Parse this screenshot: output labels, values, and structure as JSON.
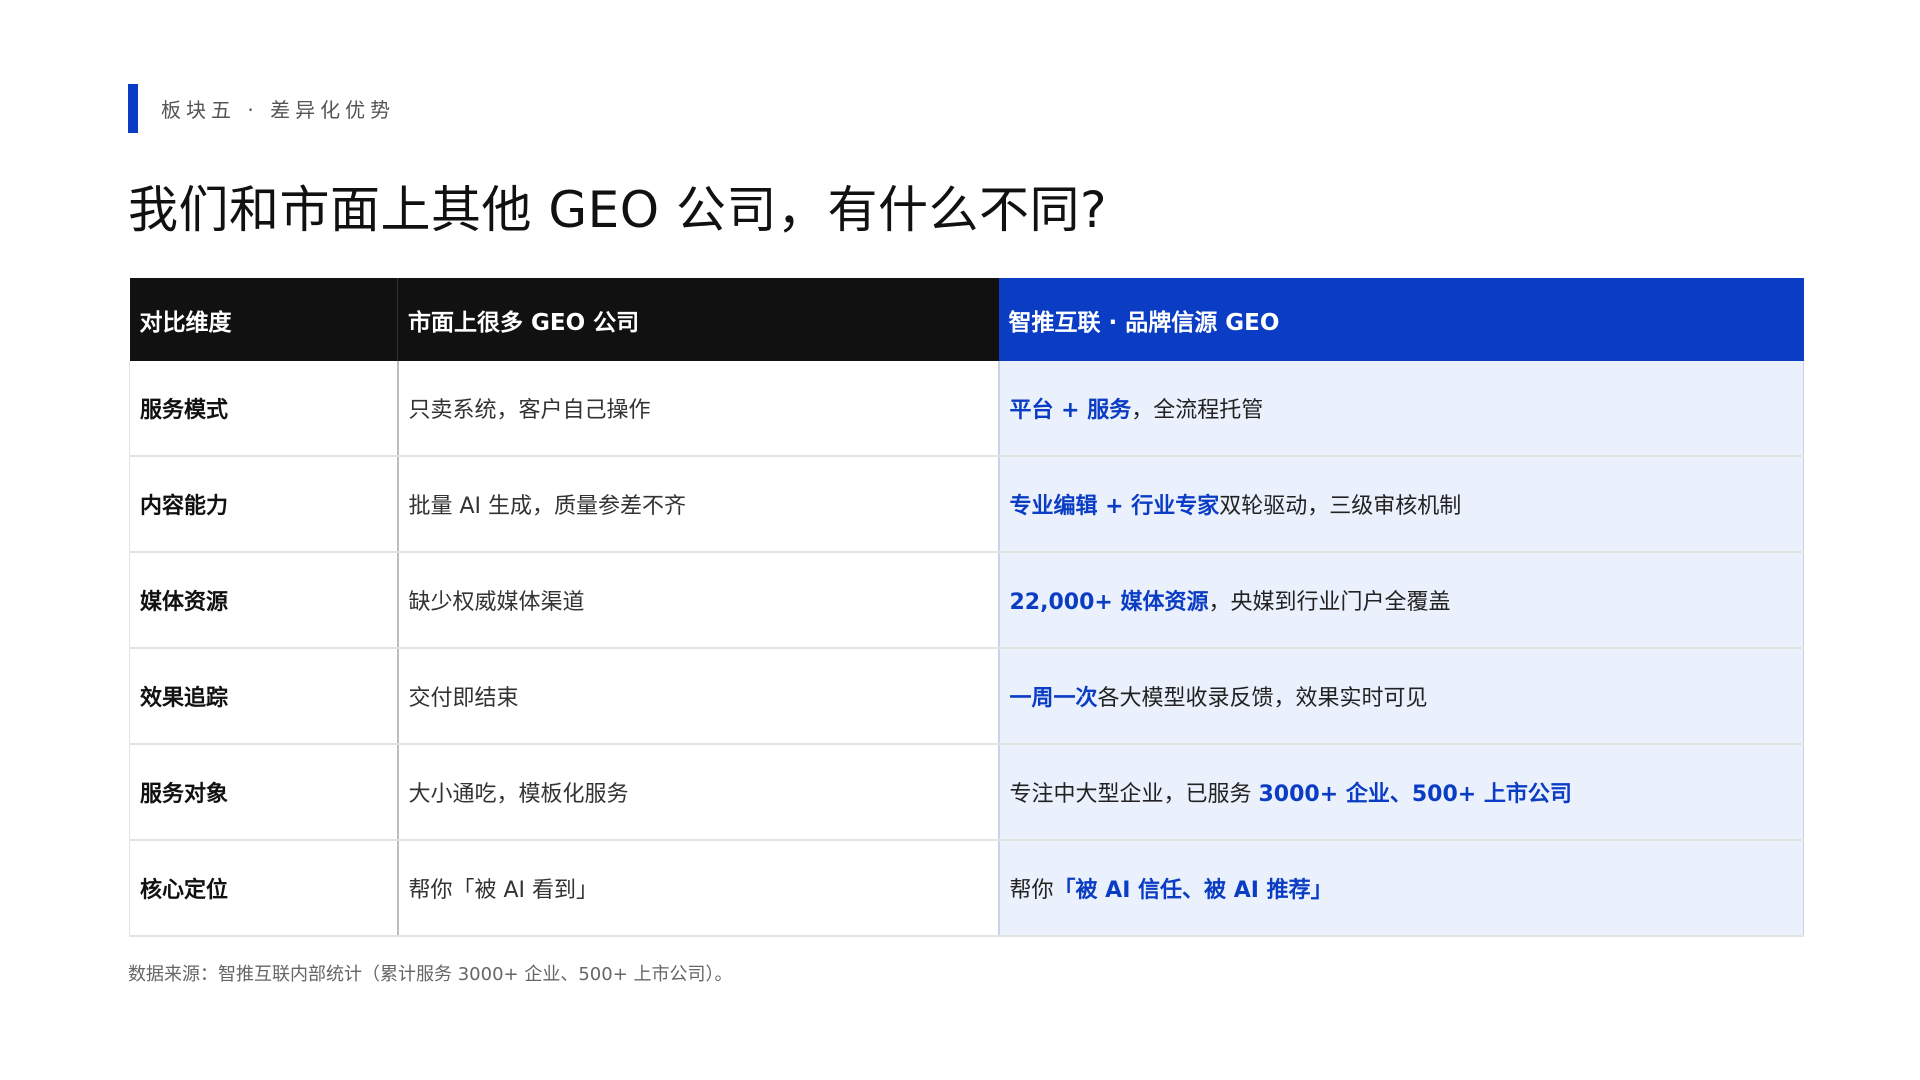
{
  "section": {
    "label": "板块五 · 差异化优势",
    "accent_color": "#0a3dc4"
  },
  "title": "我们和市面上其他 GEO 公司，有什么不同?",
  "table": {
    "headers": [
      "对比维度",
      "市面上很多 GEO 公司",
      "智推互联 · 品牌信源 GEO"
    ],
    "rows": [
      {
        "dimension": "服务模式",
        "others": "只卖系统，客户自己操作",
        "ours": [
          {
            "text": "平台 + 服务",
            "hl": true
          },
          {
            "text": "，全流程托管",
            "hl": false
          }
        ]
      },
      {
        "dimension": "内容能力",
        "others": "批量 AI 生成，质量参差不齐",
        "ours": [
          {
            "text": "专业编辑 + 行业专家",
            "hl": true
          },
          {
            "text": "双轮驱动，三级审核机制",
            "hl": false
          }
        ]
      },
      {
        "dimension": "媒体资源",
        "others": "缺少权威媒体渠道",
        "ours": [
          {
            "text": "22,000+ 媒体资源",
            "hl": true
          },
          {
            "text": "，央媒到行业门户全覆盖",
            "hl": false
          }
        ]
      },
      {
        "dimension": "效果追踪",
        "others": "交付即结束",
        "ours": [
          {
            "text": "一周一次",
            "hl": true
          },
          {
            "text": "各大模型收录反馈，效果实时可见",
            "hl": false
          }
        ]
      },
      {
        "dimension": "服务对象",
        "others": "大小通吃，模板化服务",
        "ours": [
          {
            "text": "专注中大型企业，已服务 ",
            "hl": false
          },
          {
            "text": "3000+ 企业、500+ 上市公司",
            "hl": true
          }
        ]
      },
      {
        "dimension": "核心定位",
        "others": "帮你「被 AI 看到」",
        "ours": [
          {
            "text": "帮你",
            "hl": false
          },
          {
            "text": "「被 AI 信任、被 AI 推荐」",
            "hl": true
          }
        ]
      }
    ]
  },
  "footnote": "数据来源：智推互联内部统计（累计服务 3000+ 企业、500+ 上市公司）。"
}
